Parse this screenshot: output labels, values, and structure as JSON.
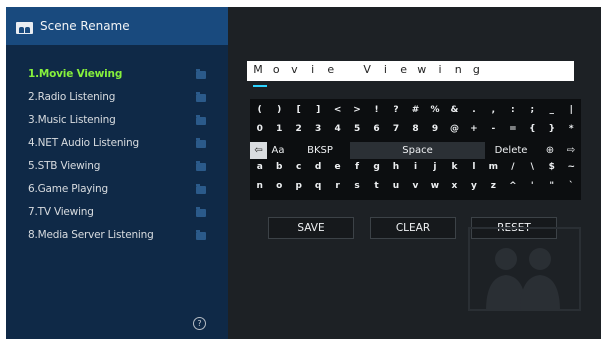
{
  "app": {
    "title": "Scene Rename",
    "icon": "scene-icon"
  },
  "scenes": [
    {
      "label": "1.Movie Viewing",
      "active": true
    },
    {
      "label": "2.Radio Listening",
      "active": false
    },
    {
      "label": "3.Music Listening",
      "active": false
    },
    {
      "label": "4.NET Audio Listening",
      "active": false
    },
    {
      "label": "5.STB Viewing",
      "active": false
    },
    {
      "label": "6.Game Playing",
      "active": false
    },
    {
      "label": "7.TV Viewing",
      "active": false
    },
    {
      "label": "8.Media Server Listening",
      "active": false
    }
  ],
  "help": {
    "label": "?"
  },
  "name_field": {
    "chars": [
      "M",
      "o",
      "v",
      "i",
      "e",
      " ",
      "V",
      "i",
      "e",
      "w",
      "i",
      "n",
      "g"
    ]
  },
  "keyboard": {
    "rows": [
      [
        "(",
        ")",
        "[",
        "]",
        "<",
        ">",
        "!",
        "?",
        "#",
        "%",
        "&",
        ".",
        ",",
        ":",
        ";",
        "_",
        "|"
      ],
      [
        "0",
        "1",
        "2",
        "3",
        "4",
        "5",
        "6",
        "7",
        "8",
        "9",
        "@",
        "+",
        "-",
        "=",
        "{",
        "}",
        "*"
      ],
      [
        "a",
        "b",
        "c",
        "d",
        "e",
        "f",
        "g",
        "h",
        "i",
        "j",
        "k",
        "l",
        "m",
        "/",
        "\\",
        "$",
        "~"
      ],
      [
        "n",
        "o",
        "p",
        "q",
        "r",
        "s",
        "t",
        "u",
        "v",
        "w",
        "x",
        "y",
        "z",
        "^",
        "'",
        "\"",
        "`"
      ]
    ],
    "left_arrow": "⇦",
    "case_toggle": "Aa",
    "backspace": "BKSP",
    "space": "Space",
    "delete": "Delete",
    "globe": "⊕",
    "right_arrow": "⇨"
  },
  "actions": {
    "save": "SAVE",
    "clear": "CLEAR",
    "reset": "RESET"
  },
  "colors": {
    "active_scene": "#86f03c",
    "sidebar_header": "#194a7e",
    "sidebar_bg": "#0f2947",
    "panel_bg": "#1d2125",
    "caret": "#2dd3ff"
  }
}
